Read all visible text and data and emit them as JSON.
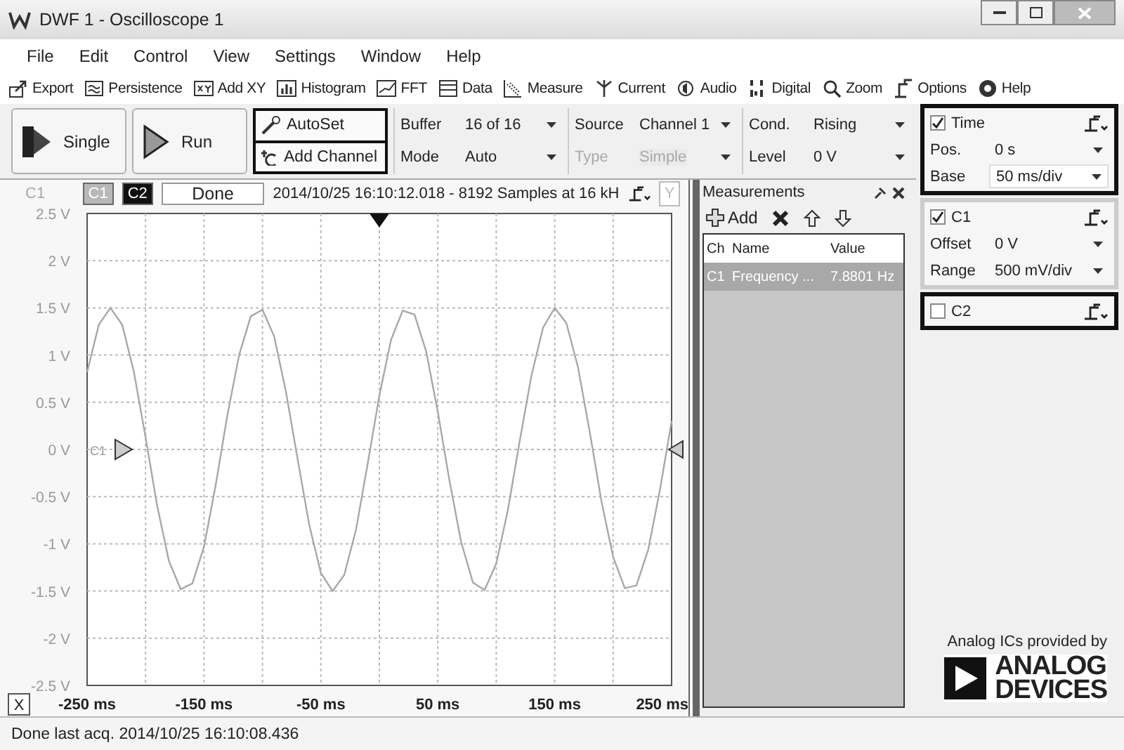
{
  "window": {
    "title": "DWF 1 - Oscilloscope 1"
  },
  "menu": [
    "File",
    "Edit",
    "Control",
    "View",
    "Settings",
    "Window",
    "Help"
  ],
  "toolbar": [
    {
      "label": "Export",
      "kind": "export"
    },
    {
      "label": "Persistence",
      "kind": "persistence"
    },
    {
      "label": "Add XY",
      "kind": "xy"
    },
    {
      "label": "Histogram",
      "kind": "histogram"
    },
    {
      "label": "FFT",
      "kind": "fft"
    },
    {
      "label": "Data",
      "kind": "data"
    },
    {
      "label": "Measure",
      "kind": "measure"
    },
    {
      "label": "Current",
      "kind": "current"
    },
    {
      "label": "Audio",
      "kind": "audio"
    },
    {
      "label": "Digital",
      "kind": "digital"
    },
    {
      "label": "Zoom",
      "kind": "zoom"
    },
    {
      "label": "Options",
      "kind": "options"
    },
    {
      "label": "Help",
      "kind": "help"
    }
  ],
  "acquisition": {
    "single": "Single",
    "run": "Run",
    "autoset": "AutoSet",
    "add_channel": "Add Channel"
  },
  "trigger_fields": [
    {
      "label": "Buffer",
      "value": "16 of 16",
      "disabled": false
    },
    {
      "label": "Mode",
      "value": "Auto",
      "disabled": false
    },
    {
      "label": "Source",
      "value": "Channel 1",
      "disabled": false
    },
    {
      "label": "Type",
      "value": "Simple",
      "disabled": true
    },
    {
      "label": "Cond.",
      "value": "Rising",
      "disabled": false
    },
    {
      "label": "Level",
      "value": "0 V",
      "disabled": false
    }
  ],
  "time": {
    "label": "Time",
    "checked": true,
    "fields": [
      {
        "label": "Pos.",
        "value": "0 s"
      },
      {
        "label": "Base",
        "value": "50 ms/div"
      }
    ]
  },
  "channels": [
    {
      "name": "C1",
      "checked": true,
      "fields": [
        {
          "label": "Offset",
          "value": "0 V"
        },
        {
          "label": "Range",
          "value": "500 mV/div"
        }
      ]
    },
    {
      "name": "C2",
      "checked": false
    }
  ],
  "plot": {
    "channel_label": "C1",
    "chips": [
      {
        "label": "C1",
        "color": "#b8b8b8"
      },
      {
        "label": "C2",
        "color": "#111111"
      }
    ],
    "status": "Done",
    "info": "2014/10/25 16:10:12.018 - 8192 Samples at 16 kH",
    "y_button": "Y",
    "x_button": "X",
    "chart_data": {
      "type": "line",
      "grid": true,
      "xlim": [
        -250,
        250
      ],
      "ylim": [
        -2.5,
        2.5
      ],
      "xticks": [
        {
          "value": -250,
          "label": "-250 ms"
        },
        {
          "value": -150,
          "label": "-150 ms"
        },
        {
          "value": -50,
          "label": "-50 ms"
        },
        {
          "value": 50,
          "label": "50 ms"
        },
        {
          "value": 150,
          "label": "150 ms"
        },
        {
          "value": 250,
          "label": "250 ms"
        }
      ],
      "yticks": [
        {
          "value": 2.5,
          "label": "2.5 V"
        },
        {
          "value": 2,
          "label": "2 V"
        },
        {
          "value": 1.5,
          "label": "1.5 V"
        },
        {
          "value": 1,
          "label": "1 V"
        },
        {
          "value": 0.5,
          "label": "0.5 V"
        },
        {
          "value": 0,
          "label": "0 V"
        },
        {
          "value": -0.5,
          "label": "-0.5 V"
        },
        {
          "value": -1,
          "label": "-1 V"
        },
        {
          "value": -1.5,
          "label": "-1.5 V"
        },
        {
          "value": -2,
          "label": "-2 V"
        },
        {
          "value": -2.5,
          "label": "-2.5 V"
        }
      ],
      "x": [
        -250,
        -240,
        -230,
        -220,
        -210,
        -200,
        -190,
        -180,
        -170,
        -160,
        -150,
        -140,
        -130,
        -120,
        -110,
        -100,
        -90,
        -80,
        -70,
        -60,
        -50,
        -40,
        -30,
        -20,
        -10,
        0,
        10,
        20,
        30,
        40,
        50,
        60,
        70,
        80,
        90,
        100,
        110,
        120,
        130,
        140,
        150,
        160,
        170,
        180,
        190,
        200,
        210,
        220,
        230,
        240,
        250
      ],
      "series": [
        {
          "name": "C1",
          "color": "#a8a8a8",
          "values": [
            0.82,
            1.32,
            1.5,
            1.32,
            0.82,
            0.13,
            -0.6,
            -1.18,
            -1.48,
            -1.42,
            -1.03,
            -0.38,
            0.36,
            1.0,
            1.41,
            1.48,
            1.2,
            0.62,
            -0.1,
            -0.8,
            -1.31,
            -1.5,
            -1.33,
            -0.85,
            -0.15,
            0.57,
            1.16,
            1.47,
            1.43,
            1.04,
            0.4,
            -0.33,
            -0.98,
            -1.41,
            -1.49,
            -1.21,
            -0.64,
            0.08,
            0.78,
            1.29,
            1.5,
            1.34,
            0.87,
            0.18,
            -0.55,
            -1.14,
            -1.47,
            -1.44,
            -1.06,
            -0.43,
            0.3
          ]
        }
      ]
    }
  },
  "measurements": {
    "title": "Measurements",
    "add": "Add",
    "columns": [
      "Ch",
      "Name",
      "Value"
    ],
    "rows": [
      {
        "ch": "C1",
        "name": "Frequency ...",
        "value": "7.8801 Hz",
        "selected": true
      }
    ]
  },
  "branding": {
    "caption": "Analog ICs provided by",
    "logo_line1": "ANALOG",
    "logo_line2": "DEVICES"
  },
  "status_bar": "Done last acq. 2014/10/25  16:10:08.436"
}
